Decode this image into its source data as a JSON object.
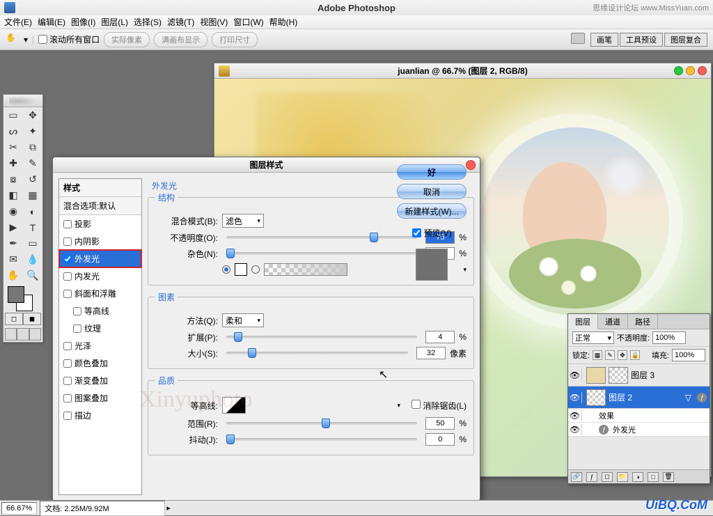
{
  "app": {
    "title": "Adobe Photoshop",
    "right_text": "思缘设计论坛 www.MissYuan.com"
  },
  "menu": {
    "items": [
      "文件(E)",
      "编辑(E)",
      "图像(I)",
      "图层(L)",
      "选择(S)",
      "滤镜(T)",
      "视图(V)",
      "窗口(W)",
      "帮助(H)"
    ]
  },
  "options": {
    "scroll_all": "滚动所有窗口",
    "actual_pixels": "实际像素",
    "fit_screen": "满画布显示",
    "print_size": "打印尺寸",
    "tabs": [
      "画笔",
      "工具预设",
      "图层复合"
    ]
  },
  "document": {
    "title": "juanlian @ 66.7% (图层 2, RGB/8)"
  },
  "dialog": {
    "title": "图层样式",
    "styles_header": "样式",
    "blend_opts": "混合选项:默认",
    "items": [
      {
        "label": "投影",
        "checked": false
      },
      {
        "label": "内阴影",
        "checked": false
      },
      {
        "label": "外发光",
        "checked": true,
        "selected": true
      },
      {
        "label": "内发光",
        "checked": false
      },
      {
        "label": "斜面和浮雕",
        "checked": false
      },
      {
        "label": "等高线",
        "checked": false,
        "sub": true
      },
      {
        "label": "纹理",
        "checked": false,
        "sub": true
      },
      {
        "label": "光泽",
        "checked": false
      },
      {
        "label": "颜色叠加",
        "checked": false
      },
      {
        "label": "渐变叠加",
        "checked": false
      },
      {
        "label": "图案叠加",
        "checked": false
      },
      {
        "label": "描边",
        "checked": false
      }
    ],
    "buttons": {
      "ok": "好",
      "cancel": "取消",
      "new_style": "新建样式(W)..."
    },
    "preview_label": "预览(V)",
    "outer_glow": {
      "title": "外发光",
      "structure": "结构",
      "blend_mode_label": "混合模式(B):",
      "blend_mode_value": "滤色",
      "opacity_label": "不透明度(O):",
      "opacity_value": "75",
      "noise_label": "杂色(N):",
      "noise_value": "0",
      "elements": "图素",
      "technique_label": "方法(Q):",
      "technique_value": "柔和",
      "spread_label": "扩展(P):",
      "spread_value": "4",
      "size_label": "大小(S):",
      "size_value": "32",
      "size_unit": "像素",
      "quality": "品质",
      "contour_label": "等高线:",
      "antialias": "消除锯齿(L)",
      "range_label": "范围(R):",
      "range_value": "50",
      "jitter_label": "抖动(J):",
      "jitter_value": "0",
      "percent": "%"
    }
  },
  "layers": {
    "tabs": [
      "图层",
      "通道",
      "路径"
    ],
    "mode_label": "正常",
    "opacity_label": "不透明度:",
    "opacity_value": "100%",
    "lock_label": "锁定:",
    "fill_label": "填充:",
    "fill_value": "100%",
    "rows": [
      {
        "name": "图层 3",
        "selected": false
      },
      {
        "name": "图层 2",
        "selected": true
      }
    ],
    "effects_label": "效果",
    "effect_item": "外发光"
  },
  "status": {
    "zoom": "66.67%",
    "docsize": "文档: 2.25M/9.92M"
  },
  "watermark": "UiBQ.CoM",
  "wm2": "Xinyuphoto"
}
